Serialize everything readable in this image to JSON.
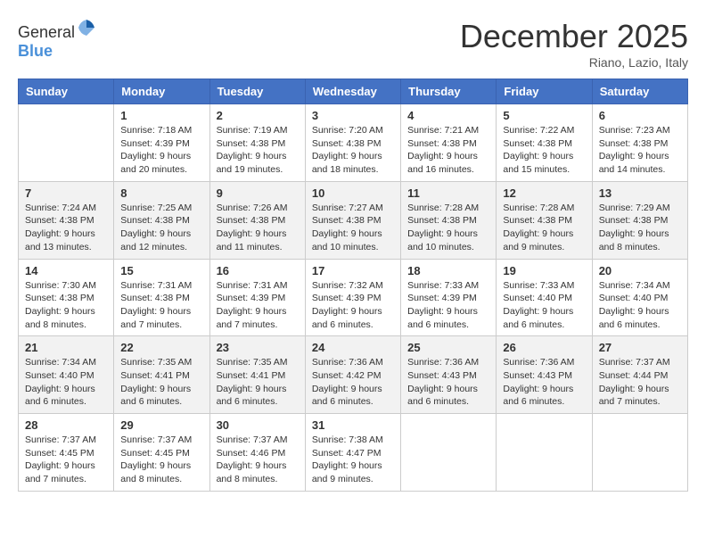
{
  "header": {
    "logo_general": "General",
    "logo_blue": "Blue",
    "month": "December 2025",
    "location": "Riano, Lazio, Italy"
  },
  "columns": [
    "Sunday",
    "Monday",
    "Tuesday",
    "Wednesday",
    "Thursday",
    "Friday",
    "Saturday"
  ],
  "weeks": [
    [
      {
        "day": "",
        "info": ""
      },
      {
        "day": "1",
        "info": "Sunrise: 7:18 AM\nSunset: 4:39 PM\nDaylight: 9 hours\nand 20 minutes."
      },
      {
        "day": "2",
        "info": "Sunrise: 7:19 AM\nSunset: 4:38 PM\nDaylight: 9 hours\nand 19 minutes."
      },
      {
        "day": "3",
        "info": "Sunrise: 7:20 AM\nSunset: 4:38 PM\nDaylight: 9 hours\nand 18 minutes."
      },
      {
        "day": "4",
        "info": "Sunrise: 7:21 AM\nSunset: 4:38 PM\nDaylight: 9 hours\nand 16 minutes."
      },
      {
        "day": "5",
        "info": "Sunrise: 7:22 AM\nSunset: 4:38 PM\nDaylight: 9 hours\nand 15 minutes."
      },
      {
        "day": "6",
        "info": "Sunrise: 7:23 AM\nSunset: 4:38 PM\nDaylight: 9 hours\nand 14 minutes."
      }
    ],
    [
      {
        "day": "7",
        "info": "Sunrise: 7:24 AM\nSunset: 4:38 PM\nDaylight: 9 hours\nand 13 minutes."
      },
      {
        "day": "8",
        "info": "Sunrise: 7:25 AM\nSunset: 4:38 PM\nDaylight: 9 hours\nand 12 minutes."
      },
      {
        "day": "9",
        "info": "Sunrise: 7:26 AM\nSunset: 4:38 PM\nDaylight: 9 hours\nand 11 minutes."
      },
      {
        "day": "10",
        "info": "Sunrise: 7:27 AM\nSunset: 4:38 PM\nDaylight: 9 hours\nand 10 minutes."
      },
      {
        "day": "11",
        "info": "Sunrise: 7:28 AM\nSunset: 4:38 PM\nDaylight: 9 hours\nand 10 minutes."
      },
      {
        "day": "12",
        "info": "Sunrise: 7:28 AM\nSunset: 4:38 PM\nDaylight: 9 hours\nand 9 minutes."
      },
      {
        "day": "13",
        "info": "Sunrise: 7:29 AM\nSunset: 4:38 PM\nDaylight: 9 hours\nand 8 minutes."
      }
    ],
    [
      {
        "day": "14",
        "info": "Sunrise: 7:30 AM\nSunset: 4:38 PM\nDaylight: 9 hours\nand 8 minutes."
      },
      {
        "day": "15",
        "info": "Sunrise: 7:31 AM\nSunset: 4:38 PM\nDaylight: 9 hours\nand 7 minutes."
      },
      {
        "day": "16",
        "info": "Sunrise: 7:31 AM\nSunset: 4:39 PM\nDaylight: 9 hours\nand 7 minutes."
      },
      {
        "day": "17",
        "info": "Sunrise: 7:32 AM\nSunset: 4:39 PM\nDaylight: 9 hours\nand 6 minutes."
      },
      {
        "day": "18",
        "info": "Sunrise: 7:33 AM\nSunset: 4:39 PM\nDaylight: 9 hours\nand 6 minutes."
      },
      {
        "day": "19",
        "info": "Sunrise: 7:33 AM\nSunset: 4:40 PM\nDaylight: 9 hours\nand 6 minutes."
      },
      {
        "day": "20",
        "info": "Sunrise: 7:34 AM\nSunset: 4:40 PM\nDaylight: 9 hours\nand 6 minutes."
      }
    ],
    [
      {
        "day": "21",
        "info": "Sunrise: 7:34 AM\nSunset: 4:40 PM\nDaylight: 9 hours\nand 6 minutes."
      },
      {
        "day": "22",
        "info": "Sunrise: 7:35 AM\nSunset: 4:41 PM\nDaylight: 9 hours\nand 6 minutes."
      },
      {
        "day": "23",
        "info": "Sunrise: 7:35 AM\nSunset: 4:41 PM\nDaylight: 9 hours\nand 6 minutes."
      },
      {
        "day": "24",
        "info": "Sunrise: 7:36 AM\nSunset: 4:42 PM\nDaylight: 9 hours\nand 6 minutes."
      },
      {
        "day": "25",
        "info": "Sunrise: 7:36 AM\nSunset: 4:43 PM\nDaylight: 9 hours\nand 6 minutes."
      },
      {
        "day": "26",
        "info": "Sunrise: 7:36 AM\nSunset: 4:43 PM\nDaylight: 9 hours\nand 6 minutes."
      },
      {
        "day": "27",
        "info": "Sunrise: 7:37 AM\nSunset: 4:44 PM\nDaylight: 9 hours\nand 7 minutes."
      }
    ],
    [
      {
        "day": "28",
        "info": "Sunrise: 7:37 AM\nSunset: 4:45 PM\nDaylight: 9 hours\nand 7 minutes."
      },
      {
        "day": "29",
        "info": "Sunrise: 7:37 AM\nSunset: 4:45 PM\nDaylight: 9 hours\nand 8 minutes."
      },
      {
        "day": "30",
        "info": "Sunrise: 7:37 AM\nSunset: 4:46 PM\nDaylight: 9 hours\nand 8 minutes."
      },
      {
        "day": "31",
        "info": "Sunrise: 7:38 AM\nSunset: 4:47 PM\nDaylight: 9 hours\nand 9 minutes."
      },
      {
        "day": "",
        "info": ""
      },
      {
        "day": "",
        "info": ""
      },
      {
        "day": "",
        "info": ""
      }
    ]
  ]
}
